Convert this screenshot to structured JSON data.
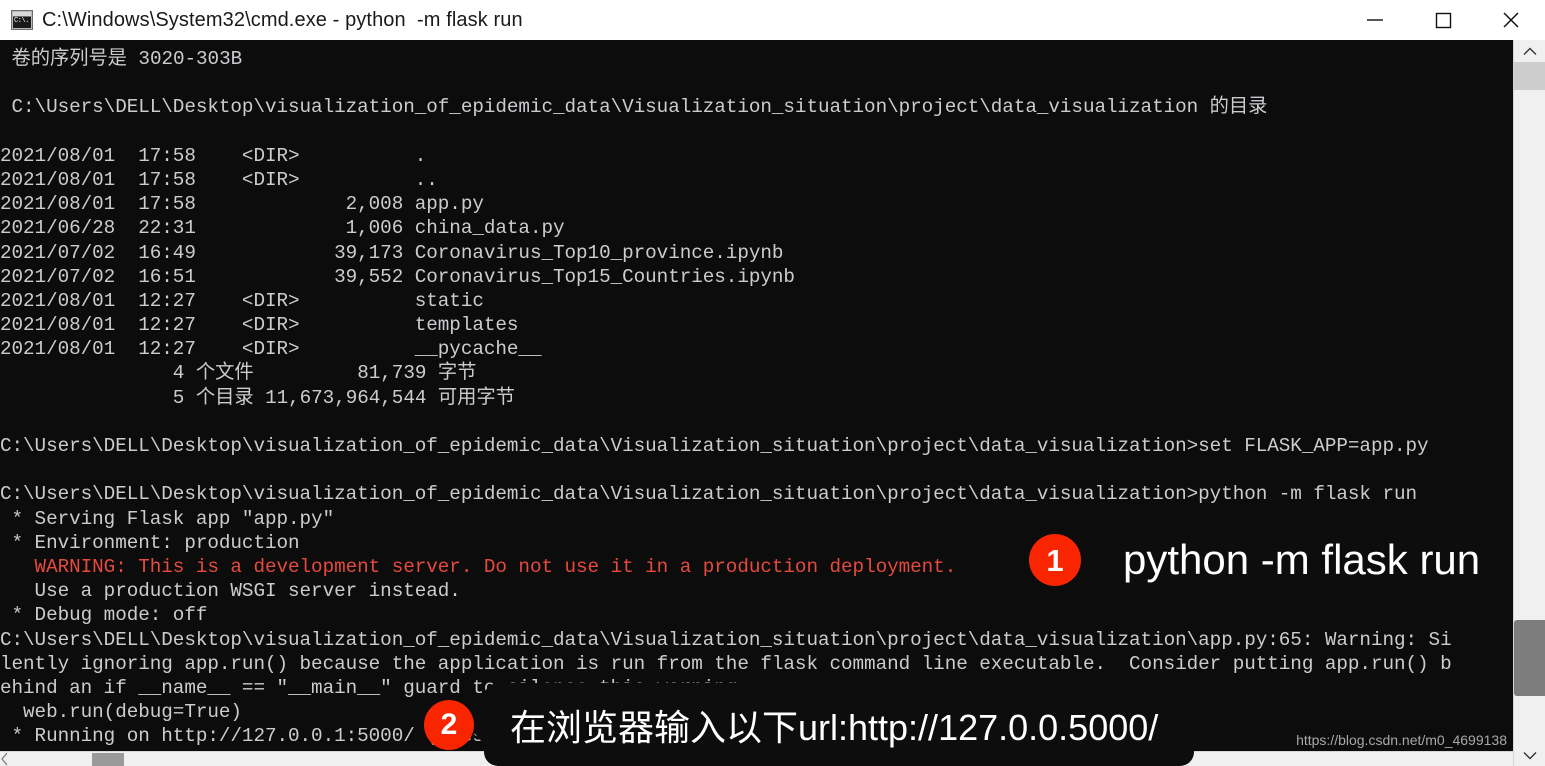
{
  "window": {
    "title": "C:\\Windows\\System32\\cmd.exe - python  -m flask run",
    "icon_label": "cmd-icon",
    "icon_glyph": "C:\\.",
    "minimize_label": "Minimize",
    "maximize_label": "Maximize",
    "close_label": "Close"
  },
  "terminal": {
    "lines": [
      {
        "text": " 卷的序列号是 3020-303B",
        "style": "normal"
      },
      {
        "text": "",
        "style": "normal"
      },
      {
        "text": " C:\\Users\\DELL\\Desktop\\visualization_of_epidemic_data\\Visualization_situation\\project\\data_visualization 的目录",
        "style": "normal"
      },
      {
        "text": "",
        "style": "normal"
      },
      {
        "text": "2021/08/01  17:58    <DIR>          .",
        "style": "normal"
      },
      {
        "text": "2021/08/01  17:58    <DIR>          ..",
        "style": "normal"
      },
      {
        "text": "2021/08/01  17:58             2,008 app.py",
        "style": "normal"
      },
      {
        "text": "2021/06/28  22:31             1,006 china_data.py",
        "style": "normal"
      },
      {
        "text": "2021/07/02  16:49            39,173 Coronavirus_Top10_province.ipynb",
        "style": "normal"
      },
      {
        "text": "2021/07/02  16:51            39,552 Coronavirus_Top15_Countries.ipynb",
        "style": "normal"
      },
      {
        "text": "2021/08/01  12:27    <DIR>          static",
        "style": "normal"
      },
      {
        "text": "2021/08/01  12:27    <DIR>          templates",
        "style": "normal"
      },
      {
        "text": "2021/08/01  12:27    <DIR>          __pycache__",
        "style": "normal"
      },
      {
        "text": "               4 个文件         81,739 字节",
        "style": "normal"
      },
      {
        "text": "               5 个目录 11,673,964,544 可用字节",
        "style": "normal"
      },
      {
        "text": "",
        "style": "normal"
      },
      {
        "text": "C:\\Users\\DELL\\Desktop\\visualization_of_epidemic_data\\Visualization_situation\\project\\data_visualization>set FLASK_APP=app.py",
        "style": "normal"
      },
      {
        "text": "",
        "style": "normal"
      },
      {
        "text": "C:\\Users\\DELL\\Desktop\\visualization_of_epidemic_data\\Visualization_situation\\project\\data_visualization>python -m flask run",
        "style": "normal"
      },
      {
        "text": " * Serving Flask app \"app.py\"",
        "style": "normal"
      },
      {
        "text": " * Environment: production",
        "style": "normal"
      },
      {
        "text": "   WARNING: This is a development server. Do not use it in a production deployment.",
        "style": "warn"
      },
      {
        "text": "   Use a production WSGI server instead.",
        "style": "normal"
      },
      {
        "text": " * Debug mode: off",
        "style": "normal"
      },
      {
        "text": "C:\\Users\\DELL\\Desktop\\visualization_of_epidemic_data\\Visualization_situation\\project\\data_visualization\\app.py:65: Warning: Si",
        "style": "normal"
      },
      {
        "text": "lently ignoring app.run() because the application is run from the flask command line executable.  Consider putting app.run() b",
        "style": "normal"
      },
      {
        "text": "ehind an if __name__ == \"__main__\" guard to silence this warning.",
        "style": "normal"
      },
      {
        "text": "  web.run(debug=True)",
        "style": "normal"
      },
      {
        "text": " * Running on http://127.0.0.1:5000/ (Press CTRL+C to quit)",
        "style": "normal"
      }
    ]
  },
  "callouts": [
    {
      "number": "1",
      "text": "python -m flask run"
    },
    {
      "number": "2",
      "text": "在浏览器输入以下url:http://127.0.0.5000/"
    }
  ],
  "watermark": "https://blog.csdn.net/m0_4699138",
  "scrollbars": {
    "vertical_up_icon": "chevron-up-icon",
    "vertical_down_icon": "chevron-down-icon",
    "horizontal_left_icon": "chevron-left-icon"
  },
  "colors": {
    "terminal_bg": "#0c0c0c",
    "terminal_fg": "#ccccd0",
    "warning_fg": "#e64a3c",
    "badge_red": "#f92500",
    "bubble_bg": "#0d0d0d"
  }
}
